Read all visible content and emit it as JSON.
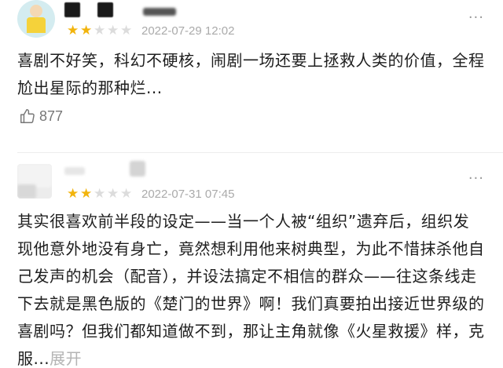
{
  "reviews": [
    {
      "rating": 2,
      "rating_max": 5,
      "date": "2022-07-29 12:02",
      "content": "喜剧不好笑，科幻不硬核，闹剧一场还要上拯救人类的价值，全程尬出星际的那种烂...",
      "likes": "877",
      "more_icon": "···",
      "avatar_icon": "cartoon-avatar-icon"
    },
    {
      "rating": 2,
      "rating_max": 5,
      "date": "2022-07-31 07:45",
      "content": "其实很喜欢前半段的设定——当一个人被“组织”遗弃后，组织发现他意外地没有身亡，竟然想利用他来树典型，为此不惜抹杀他自己发声的机会（配音），并设法搞定不相信的群众——往这条线走下去就是黑色版的《楚门的世界》啊！我们真要拍出接近世界级的喜剧吗？但我们都知道做不到，那让主角就像《火星救援》样，克服...",
      "expand_label": "展开",
      "more_icon": "···",
      "avatar_icon": "blurred-avatar-icon"
    }
  ],
  "colors": {
    "star_filled": "#f2b40d",
    "star_empty": "#dcdcdc",
    "date": "#aaaaaa",
    "text": "#1e1e1e",
    "expand": "#b4b4b4"
  }
}
